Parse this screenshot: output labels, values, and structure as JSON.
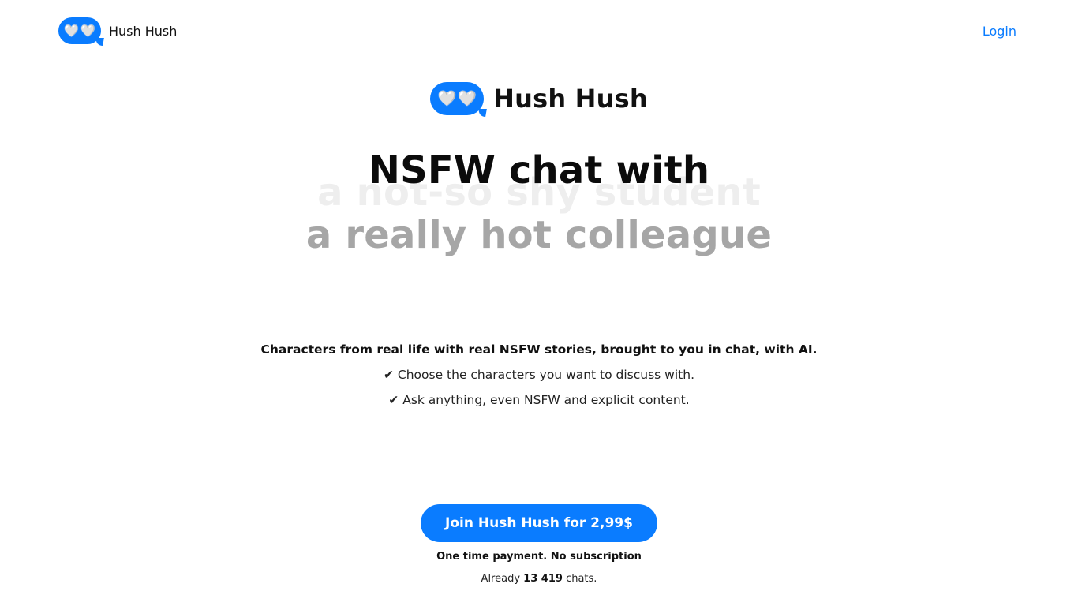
{
  "brand": {
    "name": "Hush Hush",
    "logo_icon": "chat-bubble-hearts-icon",
    "logo_hearts": [
      "🤍",
      "🤍"
    ],
    "accent_color": "#0a7cff"
  },
  "nav": {
    "login_label": "Login"
  },
  "hero": {
    "headline": "NSFW chat with",
    "rotating_previous": "a not-so shy student",
    "rotating_current": "a really hot colleague"
  },
  "description": {
    "lead": "Characters from real life with real NSFW stories, brought to you in chat, with AI.",
    "features": [
      "✔ Choose the characters you want to discuss with.",
      "✔ Ask anything, even NSFW and explicit content."
    ]
  },
  "cta": {
    "button_label": "Join Hush Hush for 2,99$",
    "note": "One time payment. No subscription",
    "count_prefix": "Already",
    "count_value": "13 419",
    "count_suffix": "chats."
  }
}
